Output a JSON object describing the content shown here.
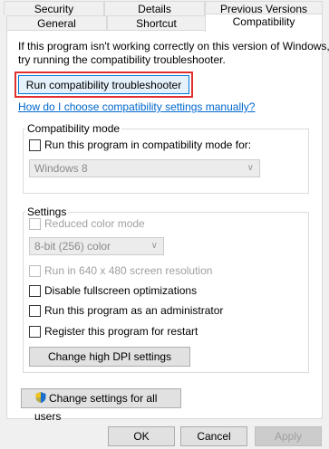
{
  "tabs": {
    "row1": [
      "Security",
      "Details",
      "Previous Versions"
    ],
    "row2": [
      "General",
      "Shortcut",
      "Compatibility"
    ]
  },
  "intro_line1": "If this program isn't working correctly on this version of Windows,",
  "intro_line2": "try running the compatibility troubleshooter.",
  "run_troubleshooter_label": "Run compatibility troubleshooter",
  "manual_link": "How do I choose compatibility settings manually?",
  "compat_mode": {
    "title": "Compatibility mode",
    "checkbox_label": "Run this program in compatibility mode for:",
    "selected_os": "Windows 8"
  },
  "settings": {
    "title": "Settings",
    "reduced_color": "Reduced color mode",
    "color_option": "8-bit (256) color",
    "resolution_640": "Run in 640 x 480 screen resolution",
    "disable_fullscreen": "Disable fullscreen optimizations",
    "run_as_admin": "Run this program as an administrator",
    "register_restart": "Register this program for restart",
    "dpi_button": "Change high DPI settings"
  },
  "all_users_button": "Change settings for all users",
  "footer": {
    "ok": "OK",
    "cancel": "Cancel",
    "apply": "Apply"
  },
  "colors": {
    "highlight_outline": "#e0312f",
    "link": "#0066cc",
    "focus_button_border": "#0078d7"
  }
}
